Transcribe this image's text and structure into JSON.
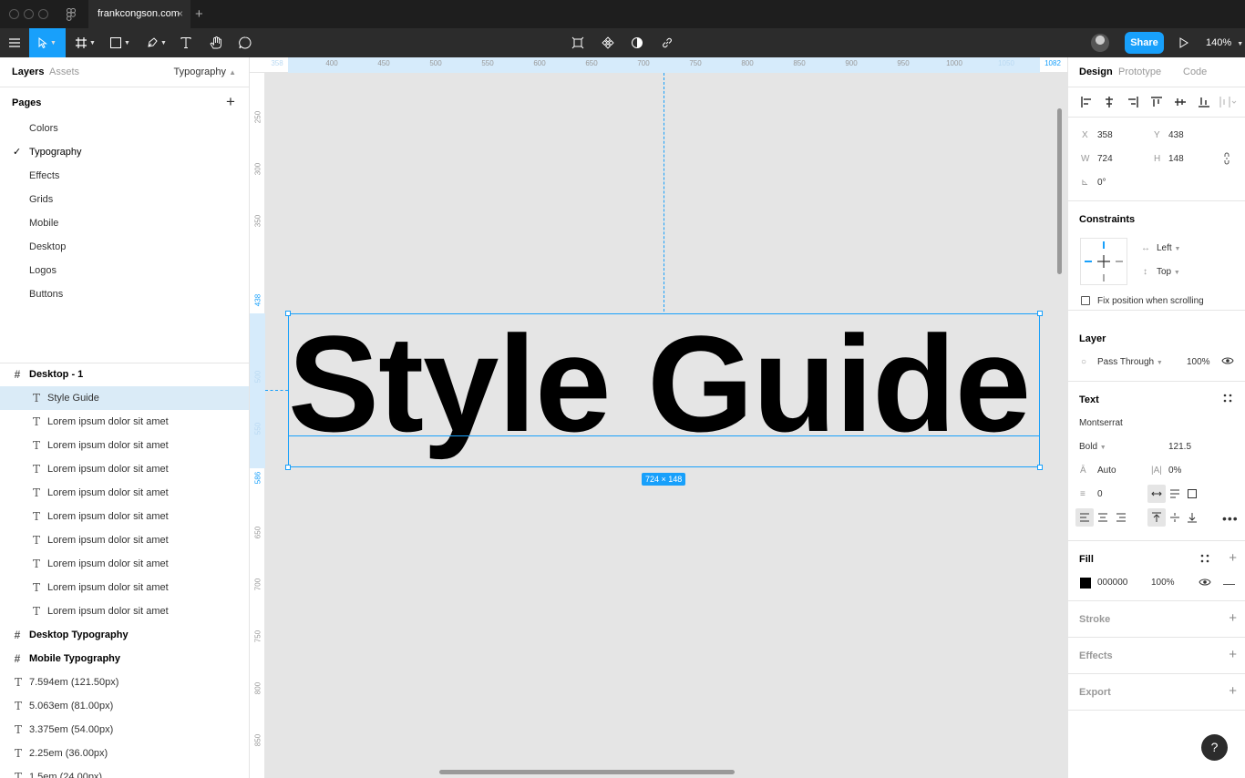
{
  "browser": {
    "tab_title": "frankcongson.com",
    "close": "×",
    "new_tab": "+"
  },
  "toolbar": {
    "share_label": "Share",
    "zoom_label": "140%"
  },
  "left_panel": {
    "tab_layers": "Layers",
    "tab_assets": "Assets",
    "current_page": "Typography",
    "pages_title": "Pages",
    "pages": [
      "Colors",
      "Typography",
      "Effects",
      "Grids",
      "Mobile",
      "Desktop",
      "Logos",
      "Buttons"
    ],
    "frame_name": "Desktop - 1",
    "selected_layer": "Style Guide",
    "child_layers": [
      "Lorem ipsum dolor sit amet",
      "Lorem ipsum dolor sit amet",
      "Lorem ipsum dolor sit amet",
      "Lorem ipsum dolor sit amet",
      "Lorem ipsum dolor sit amet",
      "Lorem ipsum dolor sit amet",
      "Lorem ipsum dolor sit amet",
      "Lorem ipsum dolor sit amet",
      "Lorem ipsum dolor sit amet"
    ],
    "frames": [
      "Desktop Typography",
      "Mobile Typography"
    ],
    "text_layers": [
      "7.594em (121.50px)",
      "5.063em (81.00px)",
      "3.375em (54.00px)",
      "2.25em (36.00px)",
      "1.5em (24.00px)"
    ]
  },
  "canvas": {
    "text": "Style Guide",
    "dimensions": "724 × 148",
    "hruler": [
      "358",
      "400",
      "450",
      "500",
      "550",
      "600",
      "650",
      "700",
      "750",
      "800",
      "850",
      "900",
      "950",
      "1000",
      "1050",
      "1082"
    ],
    "vruler": [
      "250",
      "300",
      "350",
      "438",
      "500",
      "550",
      "586",
      "650",
      "700",
      "750",
      "800",
      "850"
    ]
  },
  "right_panel": {
    "tab_design": "Design",
    "tab_prototype": "Prototype",
    "tab_code": "Code",
    "x_label": "X",
    "x": "358",
    "y_label": "Y",
    "y": "438",
    "w_label": "W",
    "w": "724",
    "h_label": "H",
    "h": "148",
    "rotation": "0°",
    "constraints_title": "Constraints",
    "constraint_h": "Left",
    "constraint_v": "Top",
    "fix_position": "Fix position when scrolling",
    "layer_title": "Layer",
    "blend_mode": "Pass Through",
    "layer_opacity": "100%",
    "text_title": "Text",
    "font_family": "Montserrat",
    "font_weight": "Bold",
    "font_size": "121.5",
    "line_height": "Auto",
    "letter_spacing": "0%",
    "paragraph_spacing": "0",
    "fill_title": "Fill",
    "fill_hex": "000000",
    "fill_opacity": "100%",
    "stroke_title": "Stroke",
    "effects_title": "Effects",
    "export_title": "Export",
    "help": "?"
  },
  "colors": {
    "accent": "#18a0fb",
    "toolbar_bg": "#2c2c2c",
    "selection_bg": "#daebf7"
  }
}
